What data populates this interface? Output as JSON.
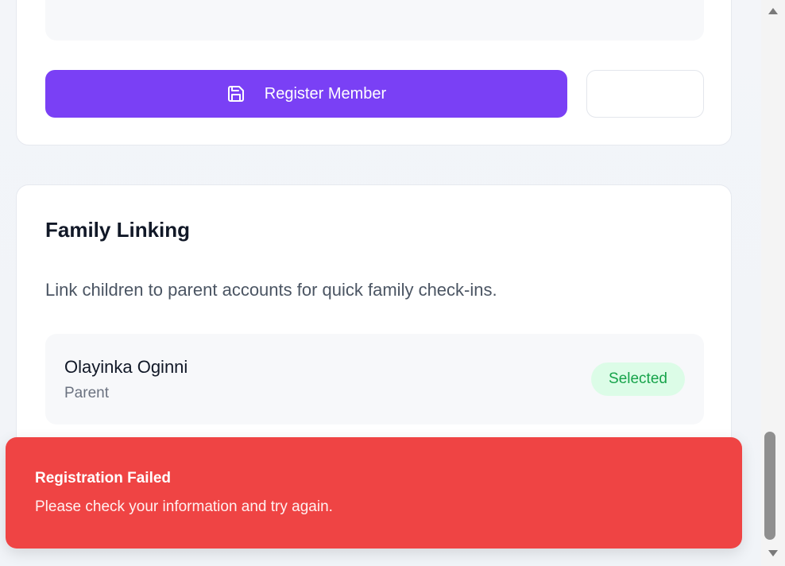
{
  "actions": {
    "register_label": "Register Member",
    "register_icon": "save-icon",
    "secondary_label": ""
  },
  "family": {
    "title": "Family Linking",
    "description": "Link children to parent accounts for quick family check-ins.",
    "members": [
      {
        "name": "Olayinka Oginni",
        "role": "Parent",
        "status": "Selected"
      }
    ]
  },
  "toast": {
    "title": "Registration Failed",
    "message": "Please check your information and try again.",
    "color": "#ef4444"
  },
  "colors": {
    "primary": "#7a40f5",
    "success_bg": "#dcfce7",
    "success_text": "#16a34a",
    "error": "#ef4444"
  },
  "scrollbar": {
    "up_icon": "arrow-up-icon",
    "down_icon": "arrow-down-icon"
  }
}
